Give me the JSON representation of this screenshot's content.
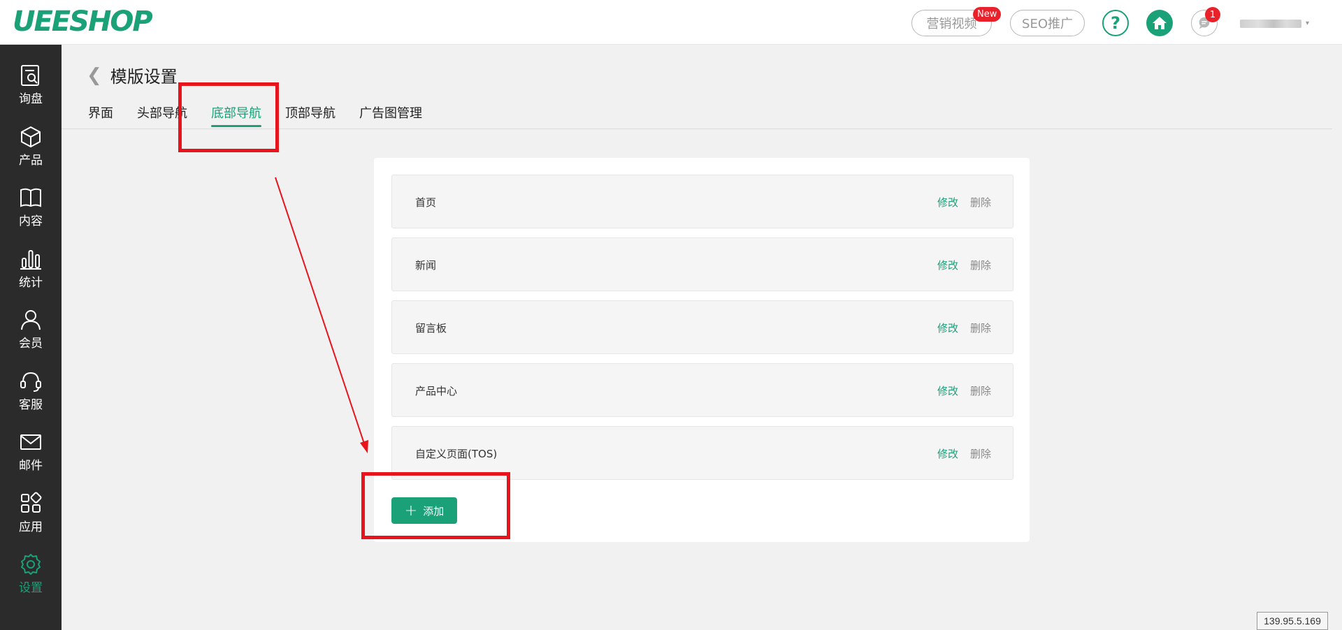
{
  "header": {
    "logo": "UEESHOP",
    "video_label": "营销视频",
    "new_badge": "New",
    "seo_label": "SEO推广",
    "help_label": "?",
    "message_count": "1",
    "user_name": ""
  },
  "sidebar": {
    "items": [
      {
        "label": "询盘",
        "icon": "inquiry-icon"
      },
      {
        "label": "产品",
        "icon": "box-icon"
      },
      {
        "label": "内容",
        "icon": "book-icon"
      },
      {
        "label": "统计",
        "icon": "bar-chart-icon"
      },
      {
        "label": "会员",
        "icon": "user-icon"
      },
      {
        "label": "客服",
        "icon": "headset-icon"
      },
      {
        "label": "邮件",
        "icon": "mail-icon"
      },
      {
        "label": "应用",
        "icon": "apps-icon"
      },
      {
        "label": "设置",
        "icon": "gear-icon",
        "active": true
      }
    ]
  },
  "page": {
    "title": "模版设置",
    "tabs": [
      {
        "label": "界面"
      },
      {
        "label": "头部导航"
      },
      {
        "label": "底部导航",
        "active": true
      },
      {
        "label": "顶部导航"
      },
      {
        "label": "广告图管理"
      }
    ]
  },
  "nav_list": {
    "edit_label": "修改",
    "delete_label": "删除",
    "items": [
      {
        "name": "首页"
      },
      {
        "name": "新闻"
      },
      {
        "name": "留言板"
      },
      {
        "name": "产品中心"
      },
      {
        "name": "自定义页面(TOS)"
      }
    ],
    "add_label": "添加"
  },
  "footer": {
    "ip": "139.95.5.169"
  },
  "colors": {
    "accent": "#1aa178",
    "sidebar_bg": "#2b2b2b",
    "annotation": "#e8141b",
    "badge": "#e8212b"
  }
}
